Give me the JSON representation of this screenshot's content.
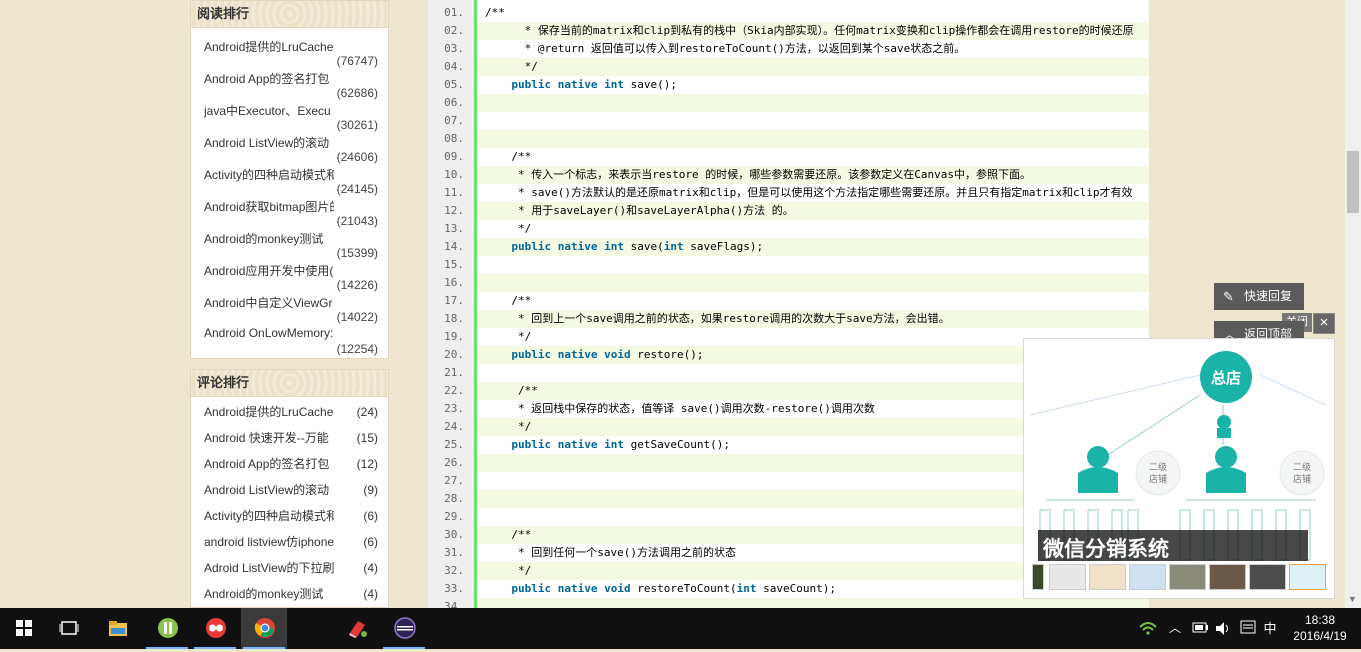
{
  "sidebar": {
    "read_rank": {
      "title": "阅读排行",
      "items": [
        {
          "title": "Android提供的LruCache",
          "count": "(76747)"
        },
        {
          "title": "Android App的签名打包",
          "count": "(62686)"
        },
        {
          "title": "java中Executor、Execu",
          "count": "(30261)"
        },
        {
          "title": "Android ListView的滚动",
          "count": "(24606)"
        },
        {
          "title": "Activity的四种启动模式和",
          "count": "(24145)"
        },
        {
          "title": "Android获取bitmap图片的",
          "count": "(21043)"
        },
        {
          "title": "Android的monkey测试",
          "count": "(15399)"
        },
        {
          "title": "Android应用开发中使用(",
          "count": "(14226)"
        },
        {
          "title": "Android中自定义ViewGr",
          "count": "(14022)"
        },
        {
          "title": "Android OnLowMemory:",
          "count": "(12254)"
        }
      ]
    },
    "comment_rank": {
      "title": "评论排行",
      "items": [
        {
          "title": "Android提供的LruCache",
          "count": "(24)"
        },
        {
          "title": "Android 快速开发--万能",
          "count": "(15)"
        },
        {
          "title": "Android App的签名打包",
          "count": "(12)"
        },
        {
          "title": "Android ListView的滚动",
          "count": "(9)"
        },
        {
          "title": "Activity的四种启动模式和",
          "count": "(6)"
        },
        {
          "title": "android listview仿iphone",
          "count": "(6)"
        },
        {
          "title": "Adroid ListView的下拉刷",
          "count": "(4)"
        },
        {
          "title": "Android的monkey测试",
          "count": "(4)"
        }
      ]
    }
  },
  "code": {
    "lines": [
      {
        "num": "01.",
        "text": "/**",
        "kind": "comment",
        "indent": 0
      },
      {
        "num": "02.",
        "text": " * 保存当前的matrix和clip到私有的栈中（Skia内部实现）。任何matrix变换和clip操作都会在调用restore的时候还原",
        "kind": "comment",
        "indent": 5
      },
      {
        "num": "03.",
        "text": " * @return 返回值可以传入到restoreToCount()方法，以返回到某个save状态之前。",
        "kind": "comment",
        "indent": 5
      },
      {
        "num": "04.",
        "text": " */",
        "kind": "comment",
        "indent": 5
      },
      {
        "num": "05.",
        "text": "public native int save();",
        "kind": "code",
        "indent": 4
      },
      {
        "num": "06.",
        "text": "",
        "kind": "code",
        "indent": 0
      },
      {
        "num": "07.",
        "text": "",
        "kind": "code",
        "indent": 0
      },
      {
        "num": "08.",
        "text": "",
        "kind": "code",
        "indent": 0
      },
      {
        "num": "09.",
        "text": "/**",
        "kind": "comment",
        "indent": 4
      },
      {
        "num": "10.",
        "text": " * 传入一个标志，来表示当restore 的时候，哪些参数需要还原。该参数定义在Canvas中，参照下面。",
        "kind": "comment",
        "indent": 4
      },
      {
        "num": "11.",
        "text": " * save()方法默认的是还原matrix和clip，但是可以使用这个方法指定哪些需要还原。并且只有指定matrix和clip才有效",
        "kind": "comment",
        "indent": 4
      },
      {
        "num": "12.",
        "text": " * 用于saveLayer()和saveLayerAlpha()方法 的。",
        "kind": "comment",
        "indent": 4
      },
      {
        "num": "13.",
        "text": " */",
        "kind": "comment",
        "indent": 4
      },
      {
        "num": "14.",
        "text": "public native int save(int saveFlags);",
        "kind": "code",
        "indent": 4
      },
      {
        "num": "15.",
        "text": "",
        "kind": "code",
        "indent": 0
      },
      {
        "num": "16.",
        "text": "",
        "kind": "code",
        "indent": 0
      },
      {
        "num": "17.",
        "text": "/**",
        "kind": "comment",
        "indent": 4
      },
      {
        "num": "18.",
        "text": " * 回到上一个save调用之前的状态，如果restore调用的次数大于save方法，会出错。",
        "kind": "comment",
        "indent": 4
      },
      {
        "num": "19.",
        "text": " */",
        "kind": "comment",
        "indent": 4
      },
      {
        "num": "20.",
        "text": "public native void restore();",
        "kind": "code",
        "indent": 4
      },
      {
        "num": "21.",
        "text": "",
        "kind": "code",
        "indent": 0
      },
      {
        "num": "22.",
        "text": " /**",
        "kind": "comment",
        "indent": 4
      },
      {
        "num": "23.",
        "text": " * 返回栈中保存的状态，值等译 save()调用次数-restore()调用次数",
        "kind": "comment",
        "indent": 4
      },
      {
        "num": "24.",
        "text": " */",
        "kind": "comment",
        "indent": 4
      },
      {
        "num": "25.",
        "text": "public native int getSaveCount();",
        "kind": "code",
        "indent": 4
      },
      {
        "num": "26.",
        "text": "",
        "kind": "code",
        "indent": 0
      },
      {
        "num": "27.",
        "text": "",
        "kind": "code",
        "indent": 0
      },
      {
        "num": "28.",
        "text": "",
        "kind": "code",
        "indent": 0
      },
      {
        "num": "29.",
        "text": "",
        "kind": "code",
        "indent": 0
      },
      {
        "num": "30.",
        "text": "/**",
        "kind": "comment",
        "indent": 4
      },
      {
        "num": "31.",
        "text": " * 回到任何一个save()方法调用之前的状态",
        "kind": "comment",
        "indent": 4
      },
      {
        "num": "32.",
        "text": " */",
        "kind": "comment",
        "indent": 4
      },
      {
        "num": "33.",
        "text": "public native void restoreToCount(int saveCount);",
        "kind": "code",
        "indent": 4
      },
      {
        "num": "34.",
        "text": "",
        "kind": "code",
        "indent": 0
      }
    ]
  },
  "float_buttons": {
    "quick_reply": "快速回复",
    "back_to_top": "返回顶部",
    "close_label": "关闭",
    "close_x": "×"
  },
  "ad": {
    "banner_text": "微信分销系统",
    "center_node": "总店",
    "side_node_1": "二级店铺",
    "side_node_2": "二级店铺",
    "accent_color": "#1ab3a7"
  },
  "taskbar": {
    "time": "18:38",
    "date": "2016/4/19",
    "ime": "中",
    "icons": [
      "start-icon",
      "task-view-icon",
      "file-explorer-icon",
      "app-green-icon",
      "app-dots-icon",
      "chrome-icon",
      "app-eraser-icon",
      "eclipse-icon"
    ]
  }
}
